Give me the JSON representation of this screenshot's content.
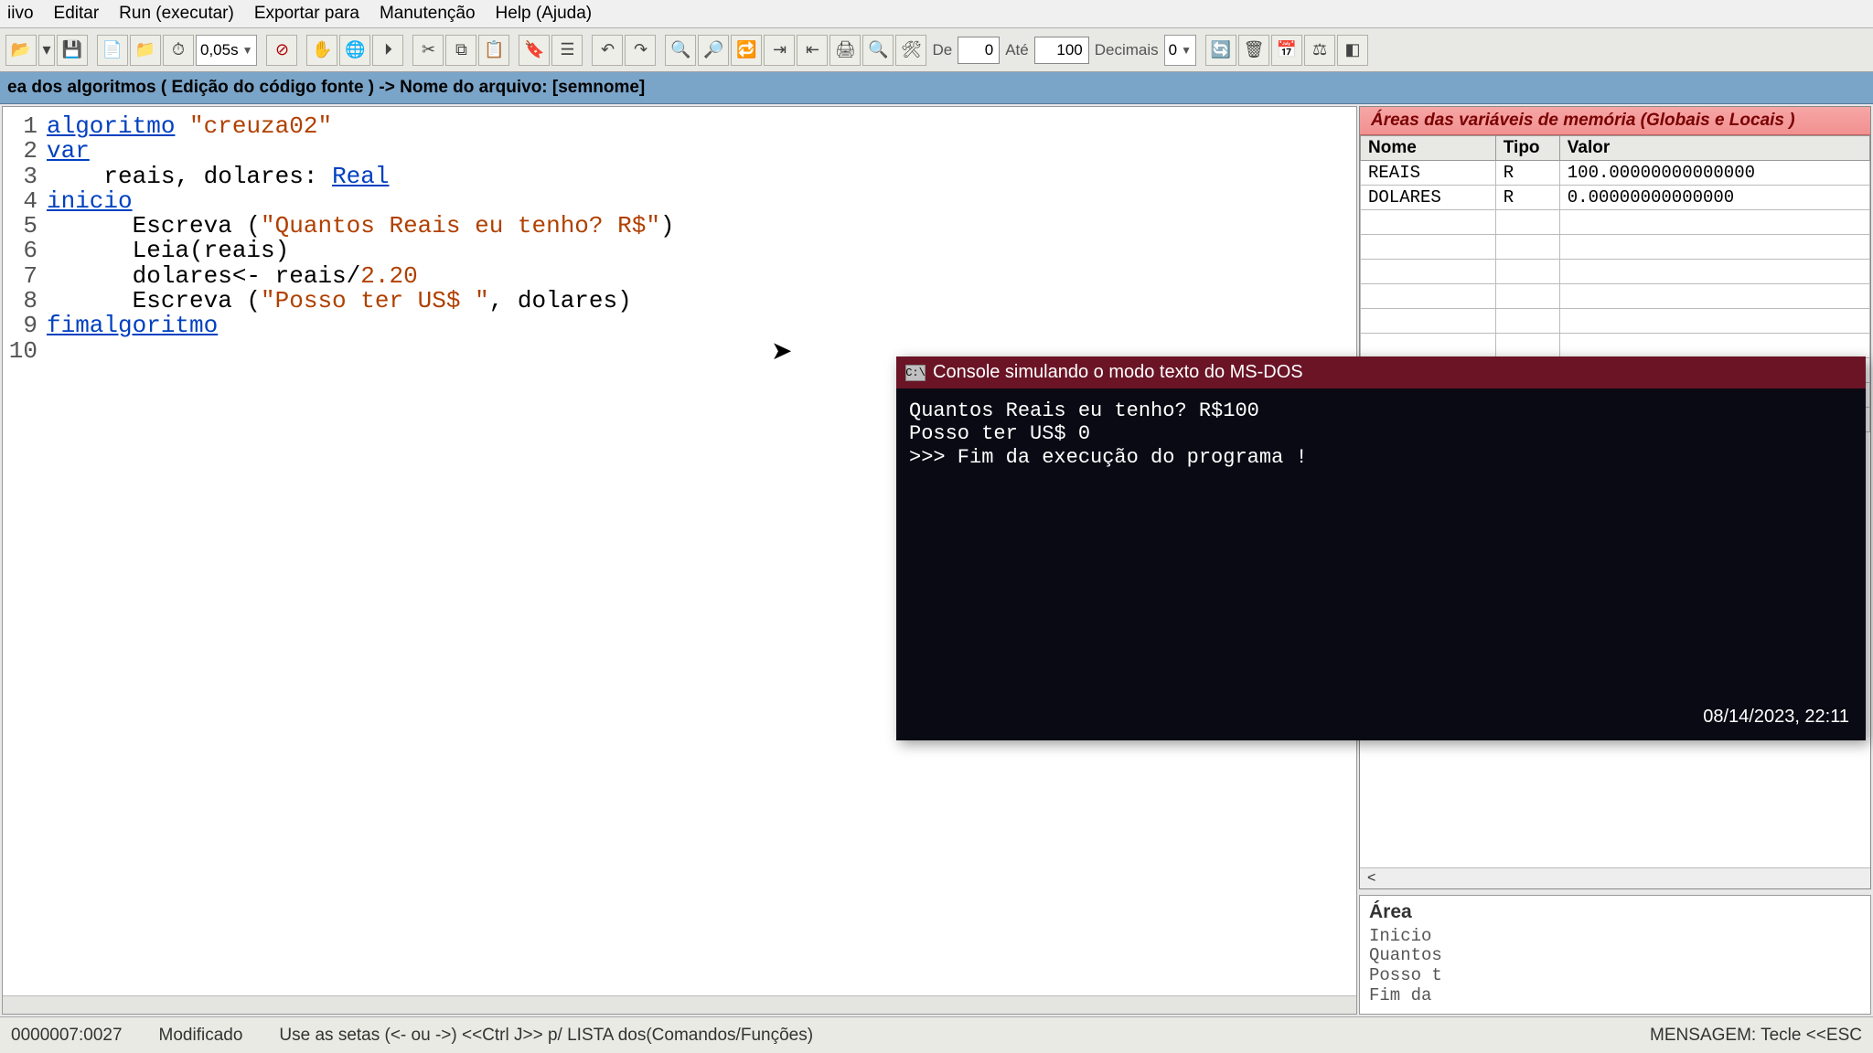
{
  "menu": {
    "arquivo": "iivo",
    "editar": "Editar",
    "run": "Run (executar)",
    "exportar": "Exportar para",
    "manutencao": "Manutenção",
    "help": "Help (Ajuda)"
  },
  "toolbar": {
    "speed": "0,05s",
    "de_label": "De",
    "de_value": "0",
    "ate_label": "Até",
    "ate_value": "100",
    "dec_label": "Decimais",
    "dec_value": "0"
  },
  "header": {
    "prefix": "ea dos algoritmos ( Edição do código fonte ) -> Nome do arquivo: ",
    "filename": "[semnome]"
  },
  "code": {
    "lines": [
      {
        "n": "1",
        "parts": [
          [
            "kw",
            "algoritmo"
          ],
          [
            "txt",
            " "
          ],
          [
            "str",
            "\"creuza02\""
          ]
        ]
      },
      {
        "n": "2",
        "parts": [
          [
            "kw",
            "var"
          ]
        ]
      },
      {
        "n": "3",
        "parts": [
          [
            "txt",
            "    reais, dolares: "
          ],
          [
            "typ",
            "Real"
          ]
        ]
      },
      {
        "n": "4",
        "parts": [
          [
            "kw",
            "inicio"
          ]
        ]
      },
      {
        "n": "5",
        "parts": [
          [
            "txt",
            "      Escreva ("
          ],
          [
            "str",
            "\"Quantos Reais eu tenho? R$\""
          ],
          [
            "txt",
            ")"
          ]
        ]
      },
      {
        "n": "6",
        "parts": [
          [
            "txt",
            "      Leia(reais)"
          ]
        ]
      },
      {
        "n": "7",
        "parts": [
          [
            "txt",
            "      dolares<- reais/"
          ],
          [
            "num",
            "2.20"
          ]
        ]
      },
      {
        "n": "8",
        "parts": [
          [
            "txt",
            "      Escreva ("
          ],
          [
            "str",
            "\"Posso ter US$ \""
          ],
          [
            "txt",
            ", dolares)"
          ]
        ]
      },
      {
        "n": "9",
        "parts": [
          [
            "kw",
            "fimalgoritmo"
          ]
        ]
      },
      {
        "n": "10",
        "parts": [
          [
            "txt",
            ""
          ]
        ]
      }
    ]
  },
  "vars": {
    "title": "Áreas das variáveis de memória (Globais e Locais )",
    "headers": {
      "nome": "Nome",
      "tipo": "Tipo",
      "valor": "Valor"
    },
    "rows": [
      {
        "nome": "REAIS",
        "tipo": "R",
        "valor": "100.00000000000000"
      },
      {
        "nome": "DOLARES",
        "tipo": "R",
        "valor": "0.00000000000000"
      }
    ],
    "collapse": "<"
  },
  "area2": {
    "title": "Área",
    "lines": [
      "Inicio",
      "Quantos",
      "Posso t",
      "Fim da"
    ]
  },
  "console": {
    "title": "Console simulando o modo texto do MS-DOS",
    "icon": "C:\\",
    "lines": [
      "Quantos Reais eu tenho? R$100",
      "Posso ter US$  0",
      ">>> Fim da execução do programa !"
    ],
    "timestamp": "08/14/2023, 22:11"
  },
  "status": {
    "pos": "0000007:0027",
    "mod": "Modificado",
    "hint": "Use as setas (<- ou ->) <<Ctrl J>> p/ LISTA dos(Comandos/Funções)",
    "msg": "MENSAGEM: Tecle <<ESC"
  }
}
